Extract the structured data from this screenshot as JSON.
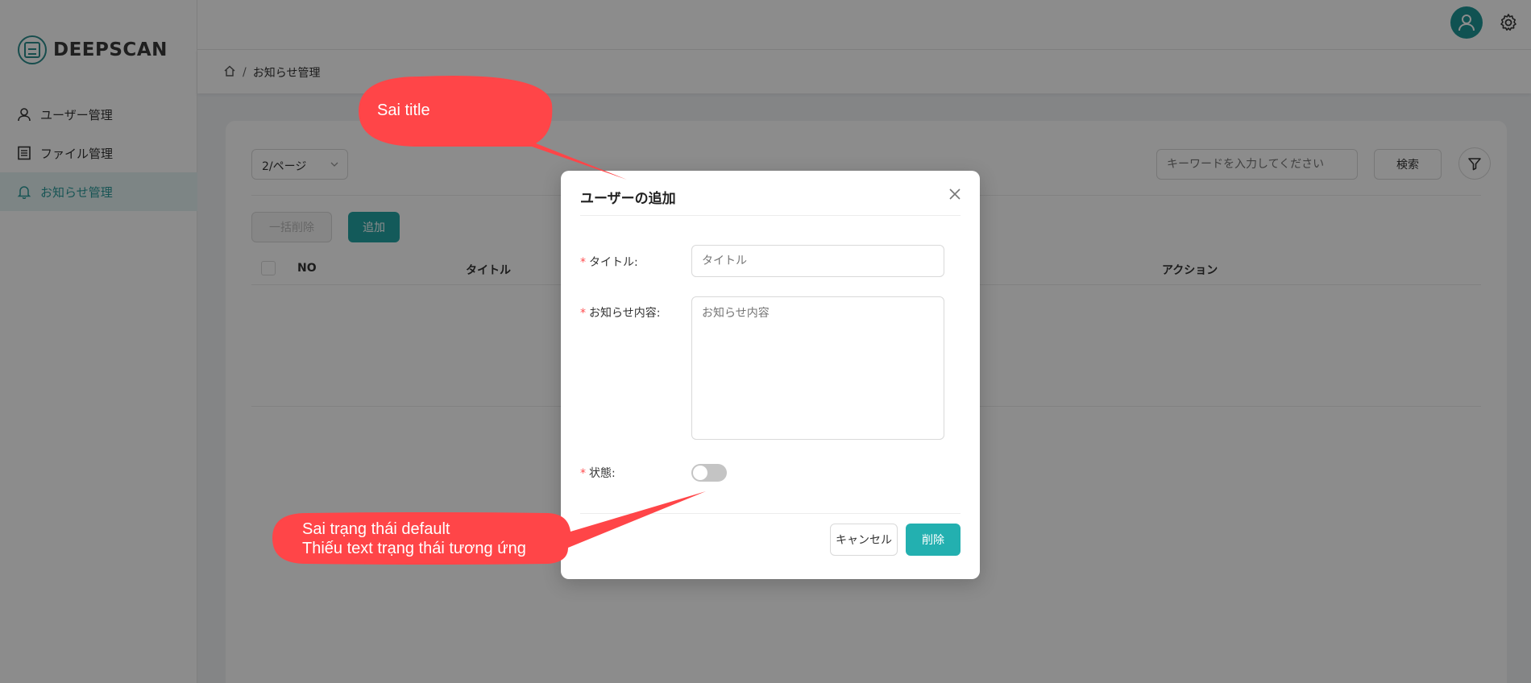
{
  "app": {
    "logo_text": "DEEPSCAN"
  },
  "sidebar": {
    "items": [
      {
        "label": "ユーザー管理"
      },
      {
        "label": "ファイル管理"
      },
      {
        "label": "お知らせ管理"
      }
    ]
  },
  "breadcrumb": {
    "current": "お知らせ管理",
    "separator": "/"
  },
  "toolbar": {
    "page_size": "2/ページ",
    "search_placeholder": "キーワードを入力してください",
    "search_button": "検索",
    "bulk_delete_button": "一括削除",
    "add_button": "追加"
  },
  "table": {
    "columns": [
      "NO",
      "タイトル",
      "アクション"
    ]
  },
  "modal": {
    "title": "ユーザーの追加",
    "fields": {
      "title_label": "タイトル:",
      "title_placeholder": "タイトル",
      "content_label": "お知らせ内容:",
      "content_placeholder": "お知らせ内容",
      "status_label": "状態:",
      "status_on": false
    },
    "cancel_button": "キャンセル",
    "submit_button": "削除"
  },
  "annotations": {
    "top": "Sai title",
    "bottom_line1": "Sai trạng thái default",
    "bottom_line2": "Thiếu text trạng thái tương ứng"
  },
  "colors": {
    "accent": "#23a5a5",
    "annotation": "#ff4548",
    "required": "#ff4d4f"
  }
}
